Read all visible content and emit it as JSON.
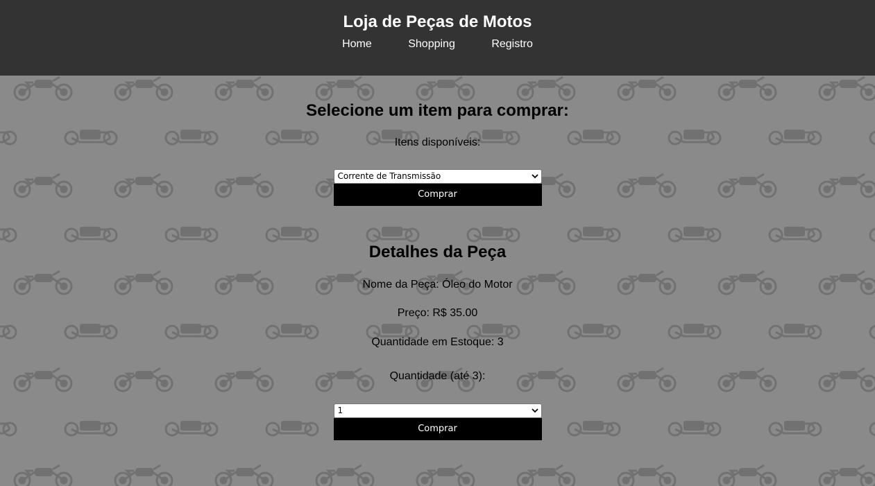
{
  "header": {
    "title": "Loja de Peças de Motos",
    "nav": [
      "Home",
      "Shopping",
      "Registro"
    ]
  },
  "purchase": {
    "heading": "Selecione um item para comprar:",
    "items_label": "Itens disponíveis:",
    "selected_item": "Corrente de Transmissão",
    "buy_label": "Comprar"
  },
  "details": {
    "heading": "Detalhes da Peça",
    "name_line": "Nome da Peça: Óleo do Motor",
    "price_line": "Preço: R$ 35.00",
    "stock_line": "Quantidade em Estoque: 3",
    "quantity_label": "Quantidade (até 3):",
    "selected_quantity": "1",
    "buy_label": "Comprar"
  },
  "colors": {
    "header_bg": "#333333",
    "page_bg": "#8a8a8a",
    "pattern": "#707070",
    "button_bg": "#000000"
  },
  "icons": {
    "background": "motorcycle-pattern-icon",
    "select_arrow": "chevron-down-icon"
  }
}
